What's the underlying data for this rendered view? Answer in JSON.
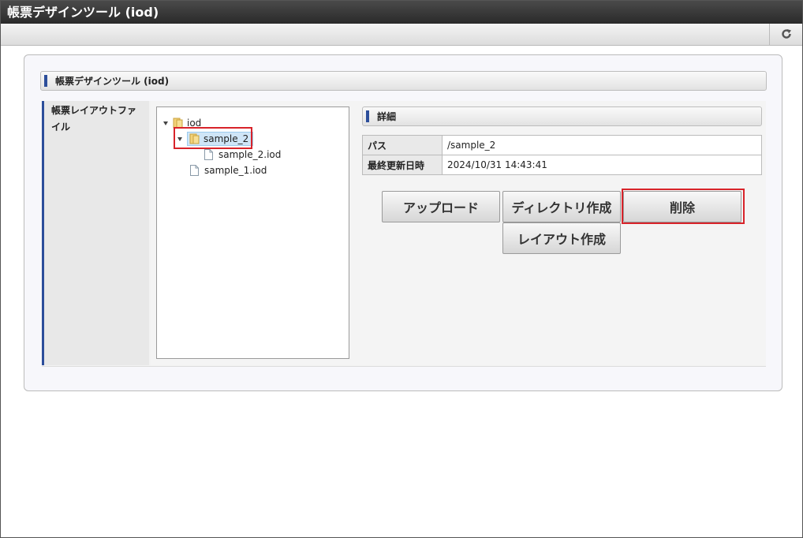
{
  "window": {
    "title": "帳票デザインツール (iod)"
  },
  "toolbar": {
    "refresh_icon": "refresh-icon"
  },
  "section": {
    "title": "帳票デザインツール (iod)"
  },
  "form": {
    "label": "帳票レイアウトファイル"
  },
  "tree": {
    "root": {
      "label": "iod",
      "icon": "folder-icon",
      "expanded": true
    },
    "folder": {
      "label": "sample_2",
      "icon": "folder-icon",
      "expanded": true,
      "selected": true
    },
    "child_file": {
      "label": "sample_2.iod",
      "icon": "file-icon"
    },
    "root_file": {
      "label": "sample_1.iod",
      "icon": "file-icon"
    }
  },
  "detail": {
    "title": "詳細",
    "rows": [
      {
        "label": "パス",
        "value": "/sample_2"
      },
      {
        "label": "最終更新日時",
        "value": "2024/10/31 14:43:41"
      }
    ]
  },
  "buttons": {
    "upload": "アップロード",
    "create_directory": "ディレクトリ作成",
    "delete": "削除",
    "create_layout": "レイアウト作成"
  },
  "colors": {
    "accent": "#2c4e9a",
    "highlight": "#d8232a",
    "titlebar": "#333333"
  }
}
